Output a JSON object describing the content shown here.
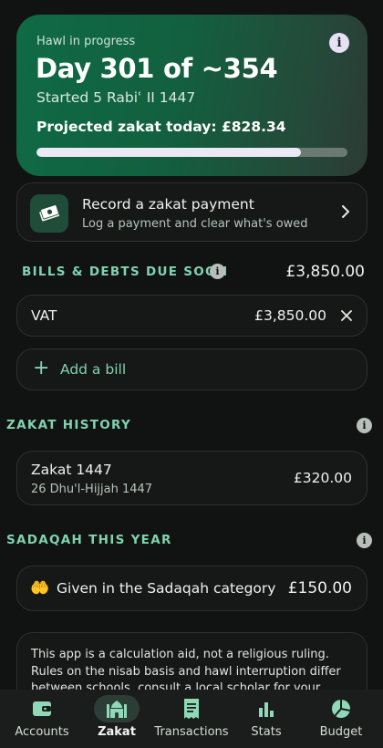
{
  "hawl": {
    "label": "Hawl in progress",
    "title": "Day 301 of ~354",
    "started": "Started 5 Rabiʿ II 1447",
    "projected": "Projected zakat today: £828.34",
    "progress_fraction": 0.85,
    "info_glyph": "i",
    "info_icon": "info-icon"
  },
  "record": {
    "title": "Record a zakat payment",
    "subtitle": "Log a payment and clear what's owed",
    "icon": "money-icon"
  },
  "bills": {
    "header": "BILLS & DEBTS DUE SOON",
    "total": "£3,850.00",
    "items": [
      {
        "label": "VAT",
        "amount": "£3,850.00"
      }
    ],
    "add_label": "Add a bill",
    "add_glyph": "+"
  },
  "history": {
    "header": "ZAKAT HISTORY",
    "items": [
      {
        "name": "Zakat 1447",
        "date": "26 Dhu'l-Hijjah 1447",
        "amount": "£320.00"
      }
    ]
  },
  "sadaqah": {
    "header": "SADAQAH THIS YEAR",
    "icon_glyph": "🤲",
    "label": "Given in the Sadaqah category",
    "amount": "£150.00"
  },
  "disclaimer": {
    "text": "This app is a calculation aid, not a religious ruling. Rules on the nisab basis and hawl interruption differ between schools, consult a local scholar for your"
  },
  "nav": {
    "items": [
      {
        "label": "Accounts",
        "icon": "wallet-icon"
      },
      {
        "label": "Zakat",
        "icon": "mosque-icon",
        "active": true
      },
      {
        "label": "Transactions",
        "icon": "receipt-icon"
      },
      {
        "label": "Stats",
        "icon": "bar-chart-icon"
      },
      {
        "label": "Budget",
        "icon": "pie-chart-icon"
      }
    ]
  },
  "colors": {
    "accent": "#7fd3b0",
    "card_green": "#0f6a45",
    "background": "#111312"
  }
}
